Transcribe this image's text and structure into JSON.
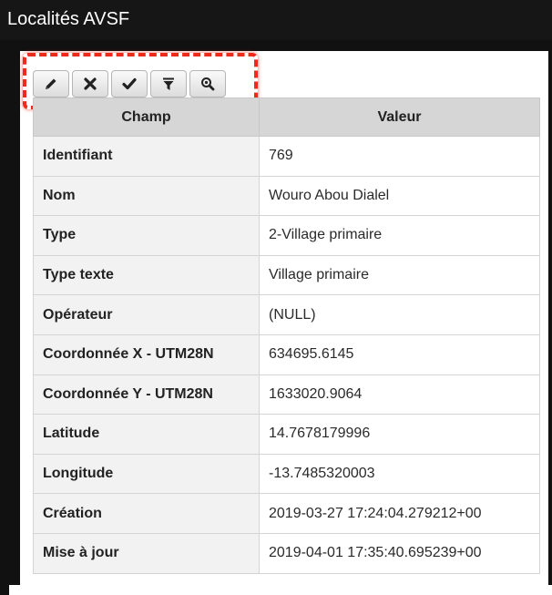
{
  "window": {
    "title": "Localités AVSF"
  },
  "toolbar": {
    "buttons": [
      {
        "icon": "pencil-icon"
      },
      {
        "icon": "close-icon"
      },
      {
        "icon": "check-icon"
      },
      {
        "icon": "filter-icon"
      },
      {
        "icon": "zoom-icon"
      }
    ],
    "highlight_color": "#ee2a1a"
  },
  "table": {
    "headers": {
      "champ": "Champ",
      "valeur": "Valeur"
    },
    "rows": [
      {
        "champ": "Identifiant",
        "valeur": "769"
      },
      {
        "champ": "Nom",
        "valeur": "Wouro Abou Dialel"
      },
      {
        "champ": "Type",
        "valeur": "2-Village primaire"
      },
      {
        "champ": "Type texte",
        "valeur": "Village primaire"
      },
      {
        "champ": "Opérateur",
        "valeur": "(NULL)"
      },
      {
        "champ": "Coordonnée X - UTM28N",
        "valeur": "634695.6145"
      },
      {
        "champ": "Coordonnée Y - UTM28N",
        "valeur": "1633020.9064"
      },
      {
        "champ": "Latitude",
        "valeur": "14.7678179996"
      },
      {
        "champ": "Longitude",
        "valeur": "-13.7485320003"
      },
      {
        "champ": "Création",
        "valeur": "2019-03-27 17:24:04.279212+00"
      },
      {
        "champ": "Mise à jour",
        "valeur": "2019-04-01 17:35:40.695239+00"
      }
    ]
  }
}
